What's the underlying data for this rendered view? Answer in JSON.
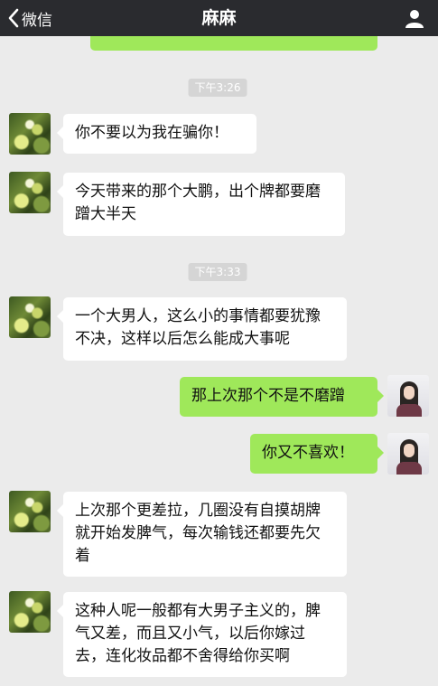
{
  "nav": {
    "back_label": "微信",
    "title": "麻麻"
  },
  "timestamps": [
    "下午3:26",
    "下午3:33"
  ],
  "messages": [
    {
      "sender": "contact",
      "text": "你不要以为我在骗你！"
    },
    {
      "sender": "contact",
      "text": "今天带来的那个大鹏，出个牌都要磨蹭大半天"
    },
    {
      "sender": "contact",
      "text": "一个大男人，这么小的事情都要犹豫不决，这样以后怎么能成大事呢"
    },
    {
      "sender": "me",
      "text": "那上次那个不是不磨蹭"
    },
    {
      "sender": "me",
      "text": "你又不喜欢！"
    },
    {
      "sender": "contact",
      "text": "上次那个更差拉，几圈没有自摸胡牌就开始发脾气，每次输钱还都要先欠着"
    },
    {
      "sender": "contact",
      "text": "这种人呢一般都有大男子主义的，脾气又差，而且又小气，以后你嫁过去，连化妆品都不舍得给你买啊"
    }
  ],
  "colors": {
    "navbar": "#2a2b2f",
    "chat_background": "#ebebeb",
    "sent_bubble": "#9fe85a",
    "received_bubble": "#ffffff",
    "timestamp_pill": "#d5d5d5"
  },
  "icons": {
    "back": "chevron-left-icon",
    "profile": "person-icon"
  }
}
